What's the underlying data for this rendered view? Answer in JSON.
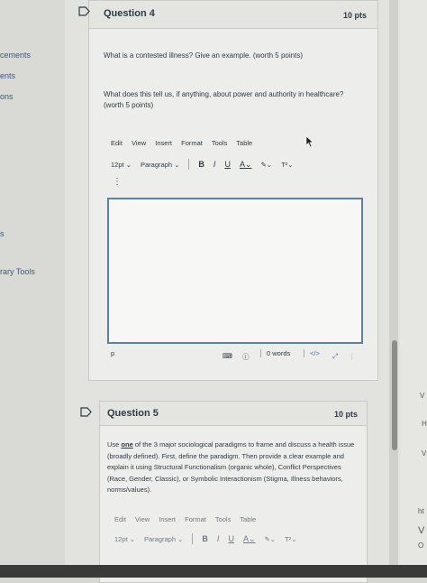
{
  "sidebar": {
    "items": [
      {
        "label": "cements"
      },
      {
        "label": "ents"
      },
      {
        "label": "ons"
      },
      {
        "label": "s"
      },
      {
        "label": "rary Tools"
      }
    ]
  },
  "question4": {
    "title": "Question 4",
    "points": "10 pts",
    "prompt1": "What is a contested illness? Give an example. (worth 5 points)",
    "prompt2": "What does this tell us, if anything, about power and authority in healthcare? (worth 5 points)",
    "editor": {
      "menu": [
        "Edit",
        "View",
        "Insert",
        "Format",
        "Tools",
        "Table"
      ],
      "font_size": "12pt",
      "block_format": "Paragraph",
      "bold": "B",
      "italic": "I",
      "underline": "U",
      "text_color": "A",
      "superscript": "T²",
      "more": "⋮",
      "path": "p",
      "word_count": "0 words",
      "html_toggle": "</>"
    }
  },
  "question5": {
    "title": "Question 5",
    "points": "10 pts",
    "prompt_prefix": "Use ",
    "prompt_emph": "one",
    "prompt_rest": " of the 3 major sociological paradigms to frame and discuss a health issue (broadly defined). First, define the paradigm. Then provide a clear example and explain it using Structural Functionalism (organic whole), Conflict Perspectives (Race, Gender, Classic), or Symbolic Interactionism (Stigma, Illness behaviors, norms/values).",
    "editor": {
      "menu": [
        "Edit",
        "View",
        "Insert",
        "Format",
        "Tools",
        "Table"
      ],
      "font_size": "12pt",
      "block_format": "Paragraph",
      "bold": "B",
      "italic": "I",
      "underline": "U",
      "text_color": "A",
      "superscript": "T²"
    }
  },
  "right_edge": {
    "fragments": [
      "V",
      "H",
      "V",
      "ht",
      "V",
      "O"
    ]
  },
  "colors": {
    "accent_border": "#5a7fa8",
    "text": "#2d3b45",
    "card_bg": "#ededeb"
  }
}
